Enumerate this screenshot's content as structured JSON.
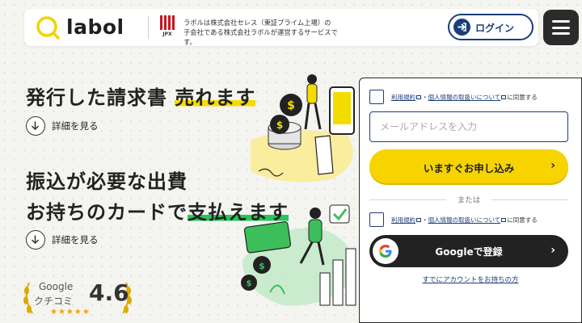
{
  "header": {
    "logo_text": "labol",
    "corp_line1": "ラボルは株式会社セレス（東証プライム上場）の",
    "corp_line2": "子会社である株式会社ラボルが運営するサービスです。",
    "jpx_label": "JPX",
    "login_label": "ログイン",
    "menu_icon": "hamburger-icon"
  },
  "hero": {
    "line1_plain": "発行した請求書 ",
    "line1_highlight": "売れます",
    "line2": "振込が必要な出費",
    "line3_plain": "お持ちのカードで",
    "line3_highlight": "支払えます",
    "detail_label_1": "詳細を見る",
    "detail_label_2": "詳細を見る"
  },
  "rating": {
    "label1": "Google",
    "label2": "クチコミ",
    "score": "4.6",
    "stars": "★★★★★"
  },
  "signup": {
    "terms_link": "利用規約",
    "privacy_link": "個人情報の取扱いについて",
    "separator": "・",
    "agree_suffix": "に同意する",
    "email_placeholder": "メールアドレスを入力",
    "apply_label": "いますぐお申し込み",
    "or_text": "または",
    "google_label": "Googleで登録",
    "has_account": "すでにアカウントをお持ちの方"
  },
  "colors": {
    "accent_yellow": "#f7d400",
    "navy": "#1c3d7a",
    "green": "#27c65a",
    "dark": "#222222"
  }
}
